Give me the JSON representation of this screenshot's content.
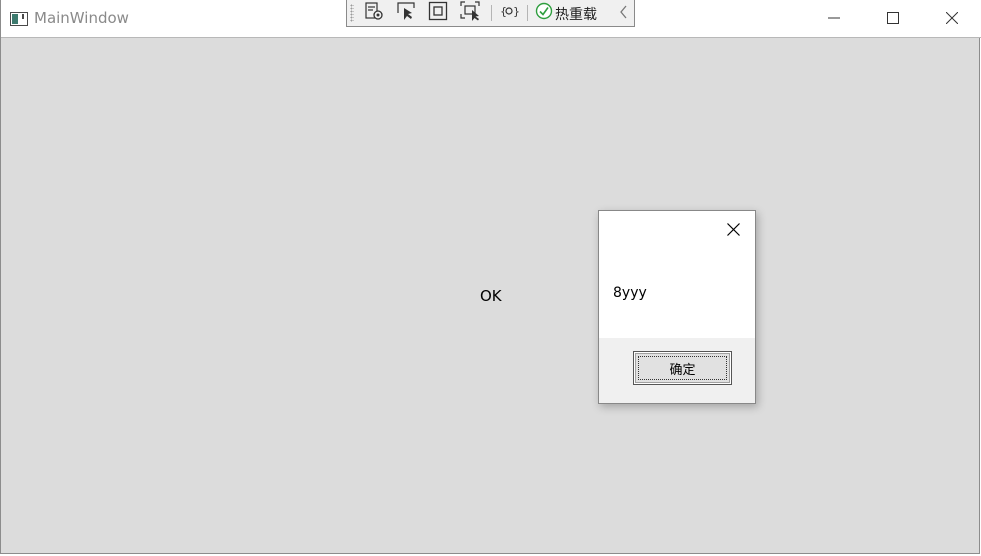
{
  "window": {
    "title": "MainWindow",
    "caption_buttons": {
      "minimize_icon": "minimize-icon",
      "maximize_icon": "maximize-icon",
      "close_icon": "close-icon"
    },
    "background_color": "#dcdcdc"
  },
  "debug_toolbar": {
    "tools": [
      {
        "icon": "live-visual-tree-icon"
      },
      {
        "icon": "select-element-icon"
      },
      {
        "icon": "display-layout-adorners-icon"
      },
      {
        "icon": "track-focused-element-icon"
      },
      {
        "icon": "binding-failures-icon"
      }
    ],
    "hot_reload_label": "热重载",
    "hot_reload_status_icon": "check-circle-icon",
    "hot_reload_status_color": "#2e9e3e",
    "collapse_icon": "chevron-left-icon"
  },
  "main": {
    "ok_text": "OK"
  },
  "message_box": {
    "message": "8yyy",
    "ok_button_label": "确定",
    "close_icon": "close-icon"
  }
}
